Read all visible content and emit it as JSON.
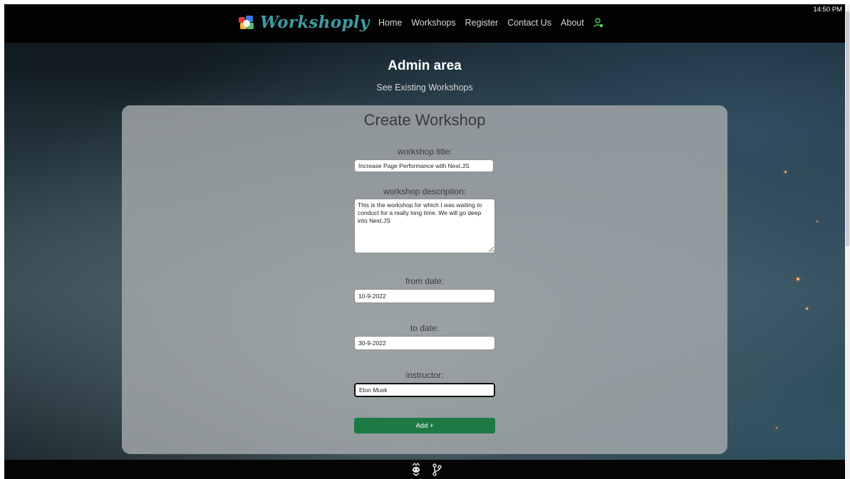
{
  "header": {
    "brand": "Workshoply",
    "nav": [
      "Home",
      "Workshops",
      "Register",
      "Contact Us",
      "About"
    ],
    "user_icon": "user-lock-icon",
    "clock": "14:50 PM"
  },
  "hero": {
    "title": "Admin area",
    "link": "See Existing Workshops"
  },
  "form": {
    "heading": "Create Workshop",
    "title_label": "workshop title:",
    "title_value": "Increase Page Performance with Next.JS",
    "description_label": "workshop description:",
    "description_value": "This is the workshop for which I was waiting to conduct for a really long time. We will go deep into Next.JS",
    "from_label": "from date:",
    "from_value": "10-9-2022",
    "to_label": "to date:",
    "to_value": "30-9-2022",
    "instructor_label": "instructor:",
    "instructor_value": "Elon Musk",
    "submit_label": "Add +",
    "submit_color": "#1d7a45"
  },
  "footer": {
    "icons": [
      "mascot-icon",
      "git-branch-icon"
    ]
  },
  "colors": {
    "brand": "#3f9aa0",
    "navbar": "#030303",
    "card": "#a5aaac"
  }
}
